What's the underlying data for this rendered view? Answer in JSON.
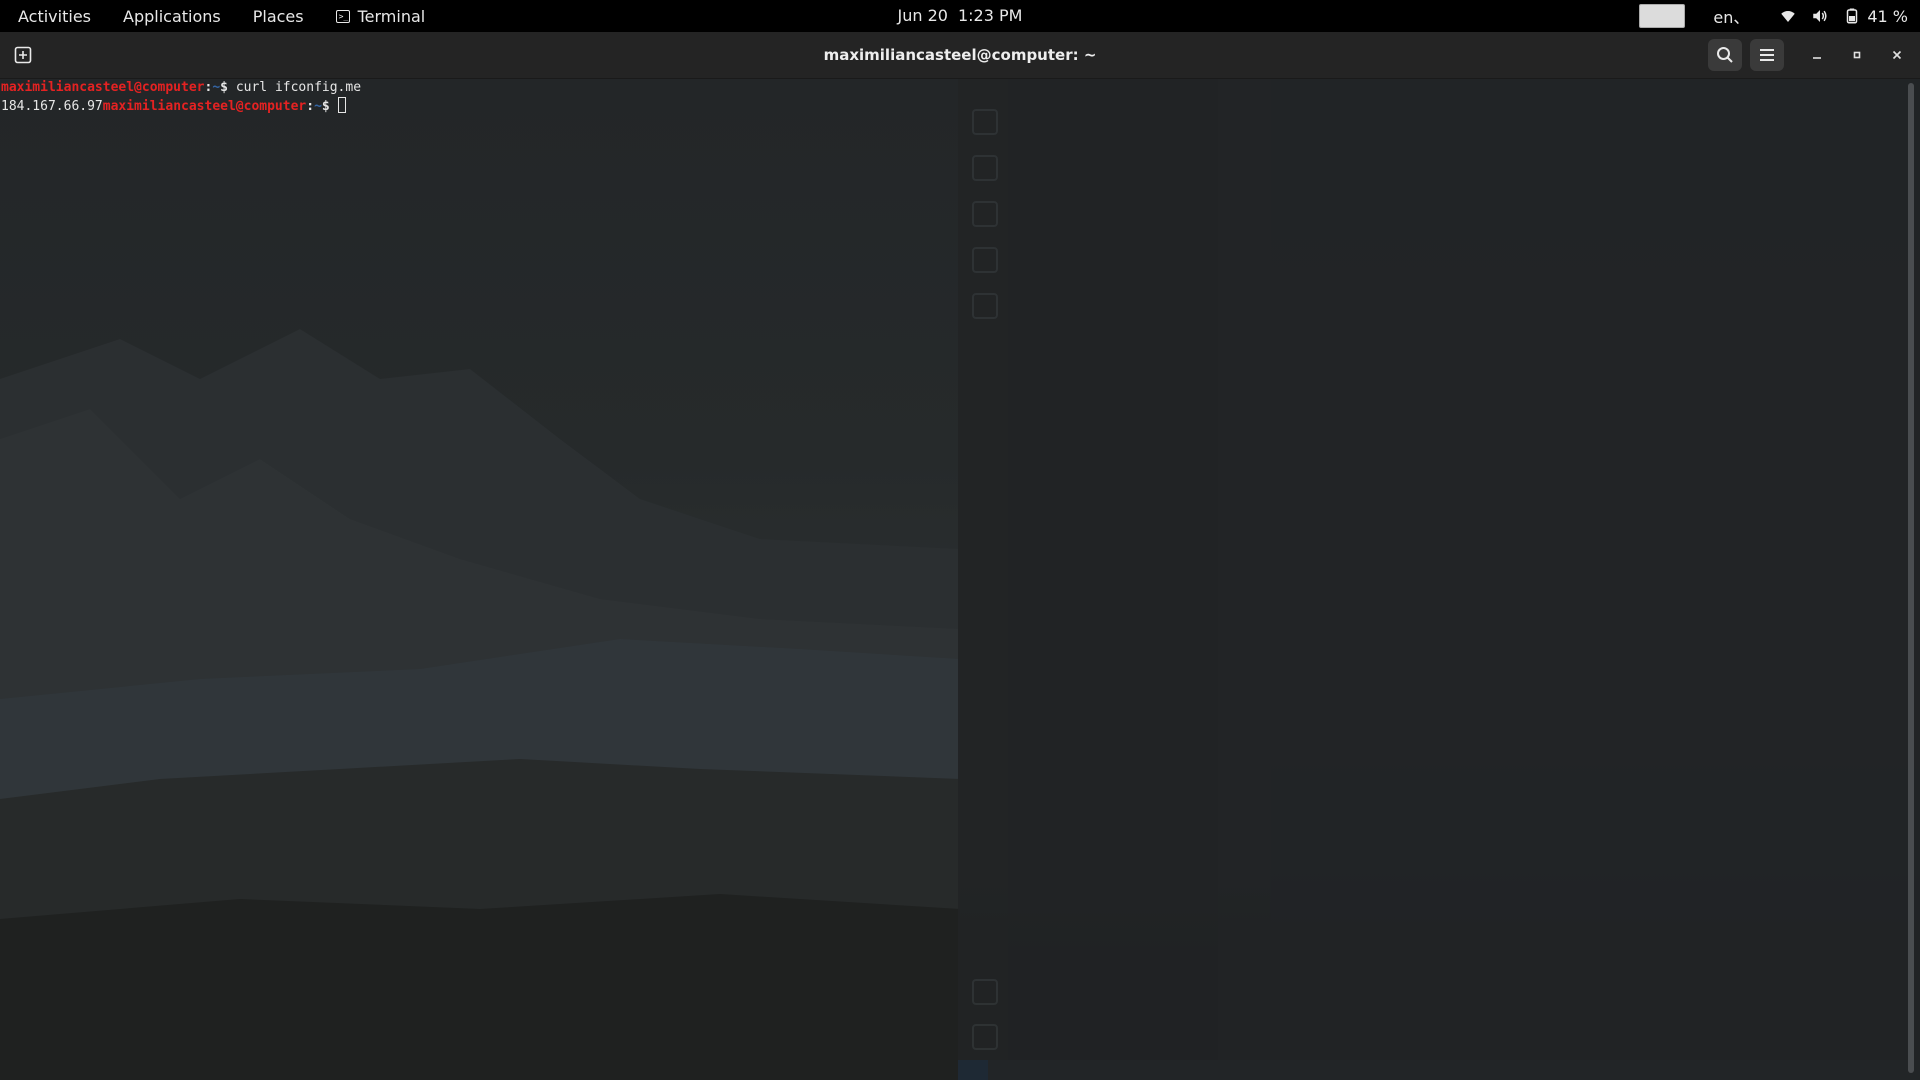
{
  "topbar": {
    "activities": "Activities",
    "applications": "Applications",
    "places": "Places",
    "terminal_app": "Terminal",
    "date": "Jun 20",
    "time": "1:23 PM",
    "language": "en、",
    "battery_percent": "41 %"
  },
  "window": {
    "title": "maximiliancasteel@computer: ~"
  },
  "terminal": {
    "line1": {
      "user_host": "maximiliancasteel@computer",
      "sep": ":",
      "path": "~",
      "dollar": "$ ",
      "command": "curl ifconfig.me"
    },
    "line2": {
      "output": "184.167.66.97",
      "user_host": "maximiliancasteel@computer",
      "sep": ":",
      "path": "~",
      "dollar": "$ "
    }
  },
  "colors": {
    "prompt_user": "#e52222",
    "prompt_path": "#3465a4",
    "topbar_bg": "#000000",
    "headerbar_bg": "#242424"
  },
  "icons": {
    "new_tab": "new-tab-icon",
    "search": "search-icon",
    "menu": "hamburger-menu-icon",
    "minimize": "minimize-icon",
    "maximize": "maximize-icon",
    "close": "close-icon",
    "wifi": "wifi-icon",
    "volume": "volume-icon",
    "battery": "battery-icon"
  }
}
